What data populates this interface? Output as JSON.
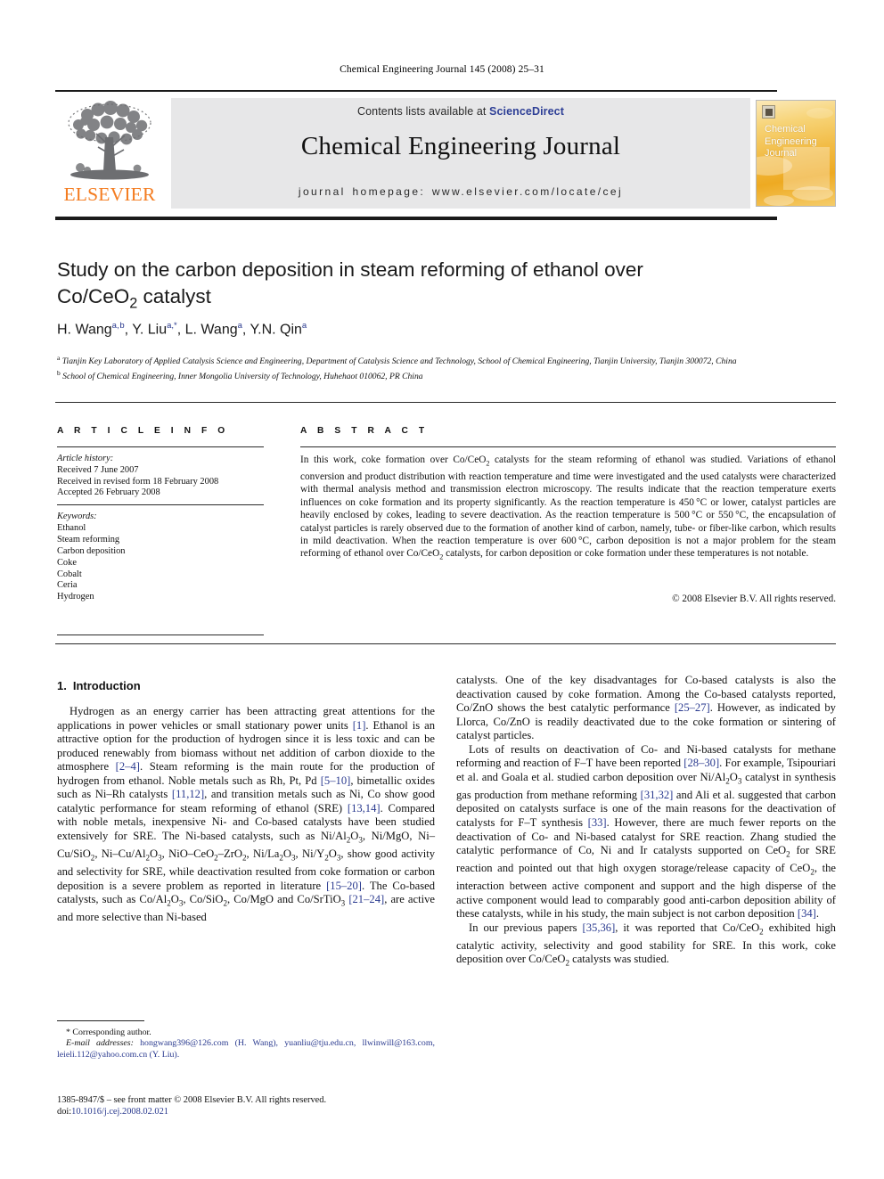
{
  "running_head": "Chemical Engineering Journal 145 (2008) 25–31",
  "header": {
    "contents_prefix": "Contents lists available at ",
    "sciencedirect": "ScienceDirect",
    "journal_title": "Chemical Engineering Journal",
    "homepage": "journal homepage: www.elsevier.com/locate/cej",
    "publisher_wordmark": "ELSEVIER",
    "cover_title": "Chemical Engineering Journal",
    "accent_blue": "#2e3f96",
    "accent_orange": "#f47c20"
  },
  "article": {
    "title": "Study on the carbon deposition in steam reforming of ethanol over Co/CeO2 catalyst",
    "title_line1": "Study on the carbon deposition in steam reforming of ethanol over",
    "title_line2_pre": "Co/CeO",
    "title_line2_sub": "2",
    "title_line2_post": " catalyst",
    "authors": "H. Wang a,b, Y. Liu a,*, L. Wang a, Y.N. Qin a",
    "affiliation_a": "Tianjin Key Laboratory of Applied Catalysis Science and Engineering, Department of Catalysis Science and Technology, School of Chemical Engineering, Tianjin University, Tianjin 300072, China",
    "affiliation_b": "School of Chemical Engineering, Inner Mongolia University of Technology, Huhehaot 010062, PR China"
  },
  "article_info": {
    "heading": "A R T I C L E   I N F O",
    "history_label": "Article history:",
    "history": [
      "Received 7 June 2007",
      "Received in revised form 18 February 2008",
      "Accepted 26 February 2008"
    ],
    "keywords_label": "Keywords:",
    "keywords": [
      "Ethanol",
      "Steam reforming",
      "Carbon deposition",
      "Coke",
      "Cobalt",
      "Ceria",
      "Hydrogen"
    ]
  },
  "abstract": {
    "heading": "A B S T R A C T",
    "text": "In this work, coke formation over Co/CeO2 catalysts for the steam reforming of ethanol was studied. Variations of ethanol conversion and product distribution with reaction temperature and time were investigated and the used catalysts were characterized with thermal analysis method and transmission electron microscopy. The results indicate that the reaction temperature exerts influences on coke formation and its property significantly. As the reaction temperature is 450 °C or lower, catalyst particles are heavily enclosed by cokes, leading to severe deactivation. As the reaction temperature is 500 °C or 550 °C, the encapsulation of catalyst particles is rarely observed due to the formation of another kind of carbon, namely, tube- or fiber-like carbon, which results in mild deactivation. When the reaction temperature is over 600 °C, carbon deposition is not a major problem for the steam reforming of ethanol over Co/CeO2 catalysts, for carbon deposition or coke formation under these temperatures is not notable.",
    "copyright": "© 2008 Elsevier B.V. All rights reserved."
  },
  "sections": {
    "intro_number": "1.",
    "intro_title": "Introduction",
    "left_paragraph_1": "Hydrogen as an energy carrier has been attracting great attentions for the applications in power vehicles or small stationary power units [1]. Ethanol is an attractive option for the production of hydrogen since it is less toxic and can be produced renewably from biomass without net addition of carbon dioxide to the atmosphere [2–4]. Steam reforming is the main route for the production of hydrogen from ethanol. Noble metals such as Rh, Pt, Pd [5–10], bimetallic oxides such as Ni–Rh catalysts [11,12], and transition metals such as Ni, Co show good catalytic performance for steam reforming of ethanol (SRE) [13,14]. Compared with noble metals, inexpensive Ni- and Co-based catalysts have been studied extensively for SRE. The Ni-based catalysts, such as Ni/Al2O3, Ni/MgO, Ni–Cu/SiO2, Ni–Cu/Al2O3, NiO–CeO2–ZrO2, Ni/La2O3, Ni/Y2O3, show good activity and selectivity for SRE, while deactivation resulted from coke formation or carbon deposition is a severe problem as reported in literature [15–20]. The Co-based catalysts, such as Co/Al2O3, Co/SiO2, Co/MgO and Co/SrTiO3 [21–24], are active and more selective than Ni-based",
    "right_paragraph_1": "catalysts. One of the key disadvantages for Co-based catalysts is also the deactivation caused by coke formation. Among the Co-based catalysts reported, Co/ZnO shows the best catalytic performance [25–27]. However, as indicated by Llorca, Co/ZnO is readily deactivated due to the coke formation or sintering of catalyst particles.",
    "right_paragraph_2": "Lots of results on deactivation of Co- and Ni-based catalysts for methane reforming and reaction of F–T have been reported [28–30]. For example, Tsipouriari et al. and Goala et al. studied carbon deposition over Ni/Al2O3 catalyst in synthesis gas production from methane reforming [31,32] and Ali et al. suggested that carbon deposited on catalysts surface is one of the main reasons for the deactivation of catalysts for F–T synthesis [33]. However, there are much fewer reports on the deactivation of Co- and Ni-based catalyst for SRE reaction. Zhang studied the catalytic performance of Co, Ni and Ir catalysts supported on CeO2 for SRE reaction and pointed out that high oxygen storage/release capacity of CeO2, the interaction between active component and support and the high disperse of the active component would lead to comparably good anti-carbon deposition ability of these catalysts, while in his study, the main subject is not carbon deposition [34].",
    "right_paragraph_3": "In our previous papers [35,36], it was reported that Co/CeO2 exhibited high catalytic activity, selectivity and good stability for SRE. In this work, coke deposition over Co/CeO2 catalysts was studied."
  },
  "footnotes": {
    "corresponding": "* Corresponding author.",
    "email_label": "E-mail addresses:",
    "emails": "hongwang396@126.com (H. Wang), yuanliu@tju.edu.cn, llwinwill@163.com, leieli.112@yahoo.com.cn (Y. Liu).",
    "issn_line": "1385-8947/$ – see front matter © 2008 Elsevier B.V. All rights reserved.",
    "doi_label": "doi:",
    "doi": "10.1016/j.cej.2008.02.021"
  }
}
